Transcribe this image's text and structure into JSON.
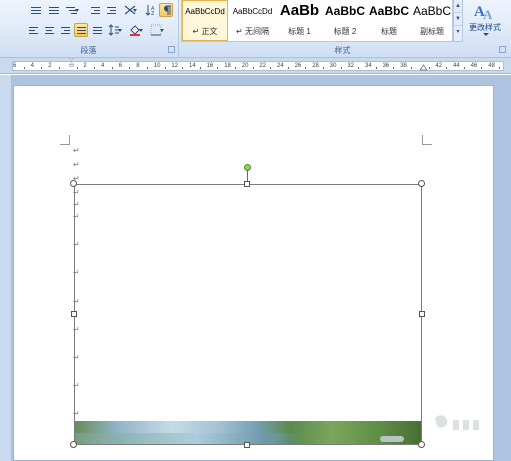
{
  "ribbon": {
    "groups": {
      "paragraph": "段落",
      "styles": "样式"
    },
    "styles_gallery": [
      {
        "sample": "AaBbCcDd",
        "name": "正文",
        "selected": true,
        "prefix": "↵"
      },
      {
        "sample": "AaBbCcDd",
        "name": "无间隔",
        "selected": false,
        "prefix": "↵"
      },
      {
        "sample": "AaBb",
        "name": "标题 1",
        "selected": false,
        "prefix": ""
      },
      {
        "sample": "AaBbC",
        "name": "标题 2",
        "selected": false,
        "prefix": ""
      },
      {
        "sample": "AaBbC",
        "name": "标题",
        "selected": false,
        "prefix": ""
      },
      {
        "sample": "AaBbC",
        "name": "副标题",
        "selected": false,
        "prefix": ""
      }
    ],
    "change_styles_label": "更改样式"
  },
  "ruler": {
    "numbers": [
      "6",
      "4",
      "2",
      "",
      "2",
      "4",
      "6",
      "8",
      "10",
      "12",
      "14",
      "16",
      "18",
      "20",
      "22",
      "24",
      "26",
      "28",
      "30",
      "32",
      "34",
      "36",
      "38",
      "",
      "42",
      "44",
      "46",
      "48"
    ]
  },
  "document": {
    "paragraph_mark": "↵"
  },
  "colors": {
    "accent": "#15428b",
    "ribbon_bg": "#dfeaf8",
    "selected_style": "#fff7da",
    "rotation_handle": "#8fd25e"
  }
}
